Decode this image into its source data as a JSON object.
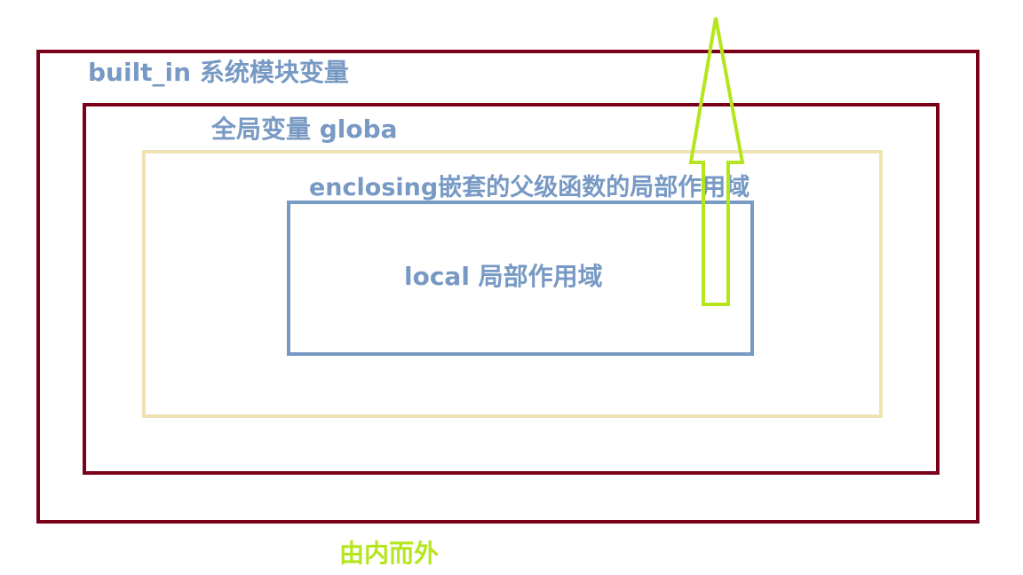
{
  "diagram": {
    "scopes": {
      "builtin": "built_in 系统模块变量",
      "global": "全局变量 globa",
      "enclosing": "enclosing嵌套的父级函数的局部作用域",
      "local": "local 局部作用域"
    },
    "direction": "由内而外"
  },
  "colors": {
    "outer_border": "#7a0019",
    "enclosing_border": "#efe3b3",
    "local_border": "#7799c3",
    "label_text": "#7799c3",
    "arrow": "#b5e61d"
  }
}
